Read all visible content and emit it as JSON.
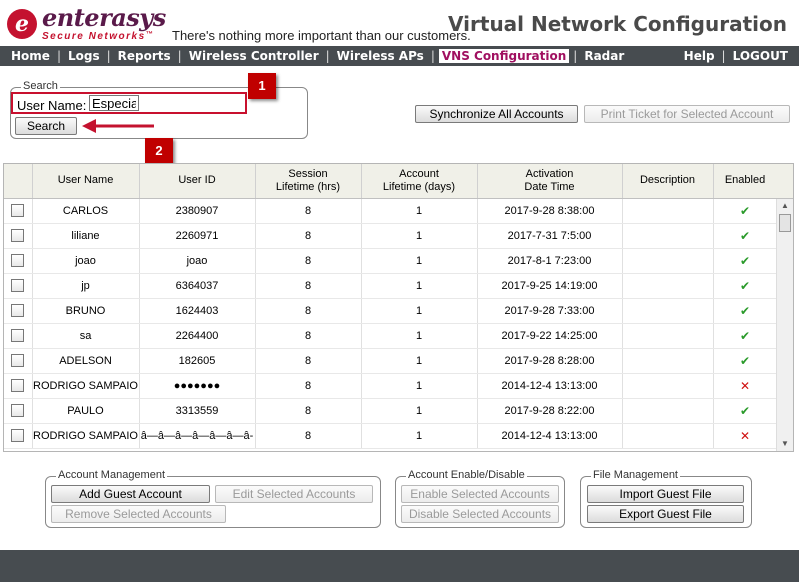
{
  "header": {
    "brand": "enterasys",
    "brand_sub": "Secure Networks",
    "trademark": "™",
    "tagline": "There's nothing more important than our customers.",
    "title": "Virtual Network Configuration"
  },
  "nav": {
    "left": [
      "Home",
      "Logs",
      "Reports",
      "Wireless Controller",
      "Wireless APs",
      "VNS Configuration",
      "Radar"
    ],
    "active": "VNS Configuration",
    "right": [
      "Help",
      "LOGOUT"
    ],
    "separator": "|"
  },
  "search": {
    "legend": "Search",
    "label": "User Name:",
    "value": "Especial",
    "button": "Search"
  },
  "toolbar": {
    "sync_button": "Synchronize All Accounts",
    "print_button": "Print Ticket for Selected Account"
  },
  "callouts": [
    "1",
    "2"
  ],
  "table": {
    "headers": {
      "user_name": "User Name",
      "user_id": "User ID",
      "session_1": "Session",
      "session_2": "Lifetime (hrs)",
      "account_1": "Account",
      "account_2": "Lifetime (days)",
      "activation_1": "Activation",
      "activation_2": "Date Time",
      "description": "Description",
      "enabled": "Enabled"
    },
    "rows": [
      {
        "user_name": "CARLOS",
        "user_id": "2380907",
        "session": "8",
        "account": "1",
        "activation": "2017-9-28 8:38:00",
        "description": "",
        "enabled": true
      },
      {
        "user_name": "liliane",
        "user_id": "2260971",
        "session": "8",
        "account": "1",
        "activation": "2017-7-31 7:5:00",
        "description": "",
        "enabled": true
      },
      {
        "user_name": "joao",
        "user_id": "joao",
        "session": "8",
        "account": "1",
        "activation": "2017-8-1 7:23:00",
        "description": "",
        "enabled": true
      },
      {
        "user_name": "jp",
        "user_id": "6364037",
        "session": "8",
        "account": "1",
        "activation": "2017-9-25 14:19:00",
        "description": "",
        "enabled": true
      },
      {
        "user_name": "BRUNO",
        "user_id": "1624403",
        "session": "8",
        "account": "1",
        "activation": "2017-9-28 7:33:00",
        "description": "",
        "enabled": true
      },
      {
        "user_name": "sa",
        "user_id": "2264400",
        "session": "8",
        "account": "1",
        "activation": "2017-9-22 14:25:00",
        "description": "",
        "enabled": true
      },
      {
        "user_name": "ADELSON",
        "user_id": "182605",
        "session": "8",
        "account": "1",
        "activation": "2017-9-28 8:28:00",
        "description": "",
        "enabled": true
      },
      {
        "user_name": "RODRIGO SAMPAIO",
        "user_id": "●●●●●●●",
        "session": "8",
        "account": "1",
        "activation": "2014-12-4 13:13:00",
        "description": "",
        "enabled": false
      },
      {
        "user_name": "PAULO",
        "user_id": "3313559",
        "session": "8",
        "account": "1",
        "activation": "2017-9-28 8:22:00",
        "description": "",
        "enabled": true
      },
      {
        "user_name": "RODRIGO SAMPAIO",
        "user_id": "â—â—â—â—â—â—â-",
        "session": "8",
        "account": "1",
        "activation": "2014-12-4 13:13:00",
        "description": "",
        "enabled": false
      }
    ],
    "enabled_symbol": "✔",
    "disabled_symbol": "✕"
  },
  "account_management": {
    "legend": "Account Management",
    "add": "Add Guest Account",
    "edit": "Edit Selected Accounts",
    "remove": "Remove Selected Accounts"
  },
  "account_enable": {
    "legend": "Account Enable/Disable",
    "enable": "Enable Selected Accounts",
    "disable": "Disable Selected Accounts"
  },
  "file_management": {
    "legend": "File Management",
    "import": "Import Guest File",
    "export": "Export Guest File"
  },
  "colors": {
    "navbar": "#474c50",
    "brand": "#5a1a4a",
    "accent_red": "#c4122f",
    "callout": "#c00000",
    "active_nav": "#a01060",
    "enabled_green": "#2a9a2a",
    "disabled_red": "#d01010"
  }
}
